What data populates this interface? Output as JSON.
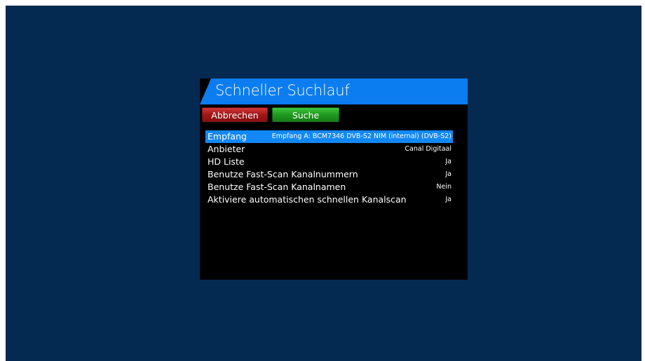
{
  "dialog": {
    "title": "Schneller Suchlauf",
    "buttons": {
      "cancel_label": "Abbrechen",
      "search_label": "Suche"
    },
    "settings": [
      {
        "label": "Empfang",
        "value": "Empfang A: BCM7346 DVB-S2 NIM (internal) (DVB-S2)"
      },
      {
        "label": "Anbieter",
        "value": "Canal Digitaal"
      },
      {
        "label": "HD Liste",
        "value": "Ja"
      },
      {
        "label": "Benutze Fast-Scan Kanalnummern",
        "value": "Ja"
      },
      {
        "label": "Benutze Fast-Scan Kanalnamen",
        "value": "Nein"
      },
      {
        "label": "Aktiviere automatischen schnellen Kanalscan",
        "value": "Ja"
      }
    ],
    "selected_index": 0
  },
  "colors": {
    "background": "#052a52",
    "title_bar": "#0b7df0",
    "selection": "#1288f6",
    "cancel_button": "#a01717",
    "search_button": "#1f9a1f"
  }
}
